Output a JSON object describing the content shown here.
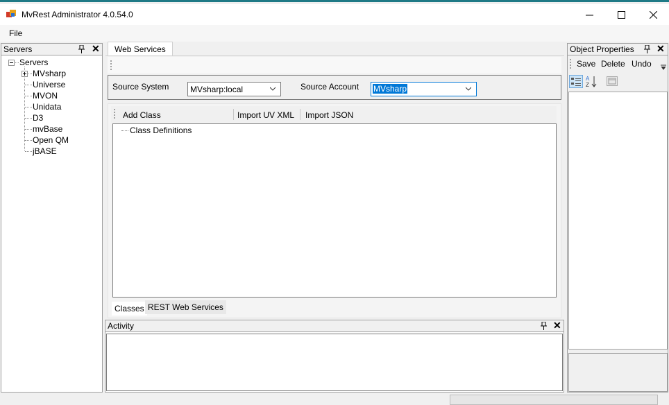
{
  "window": {
    "title": "MvRest Administrator 4.0.54.0",
    "icon": "app-window-icon",
    "accent": "#1f7a86"
  },
  "menu": {
    "file": "File"
  },
  "servers_panel": {
    "title": "Servers",
    "root": "Servers",
    "items": [
      "MVsharp",
      "Universe",
      "MVON",
      "Unidata",
      "D3",
      "mvBase",
      "Open QM",
      "jBASE"
    ]
  },
  "document": {
    "tab": "Web Services",
    "source_system_label": "Source System",
    "source_system_value": "MVsharp:local",
    "source_account_label": "Source Account",
    "source_account_value": "MVsharp",
    "toolbar": {
      "add_class": "Add Class",
      "import_uv_xml": "Import UV XML",
      "import_json": "Import JSON"
    },
    "tree_root": "Class Definitions",
    "bottom_tabs": [
      "Classes",
      "REST Web Services"
    ],
    "selected_color": "#0078d7"
  },
  "activity_panel": {
    "title": "Activity"
  },
  "properties_panel": {
    "title": "Object Properties",
    "save": "Save",
    "delete": "Delete",
    "undo": "Undo"
  }
}
